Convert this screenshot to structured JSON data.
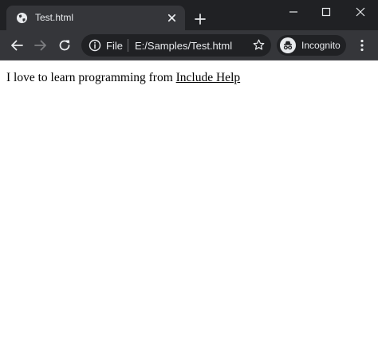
{
  "browser": {
    "tab": {
      "title": "Test.html"
    },
    "omnibox": {
      "scheme_label": "File",
      "url": "E:/Samples/Test.html"
    },
    "profile": {
      "label": "Incognito"
    },
    "colors": {
      "frame": "#202124",
      "toolbar": "#35363a",
      "text": "#e8eaed"
    }
  },
  "page": {
    "paragraph_text": "I love to learn programming from ",
    "link_text": "Include Help"
  }
}
